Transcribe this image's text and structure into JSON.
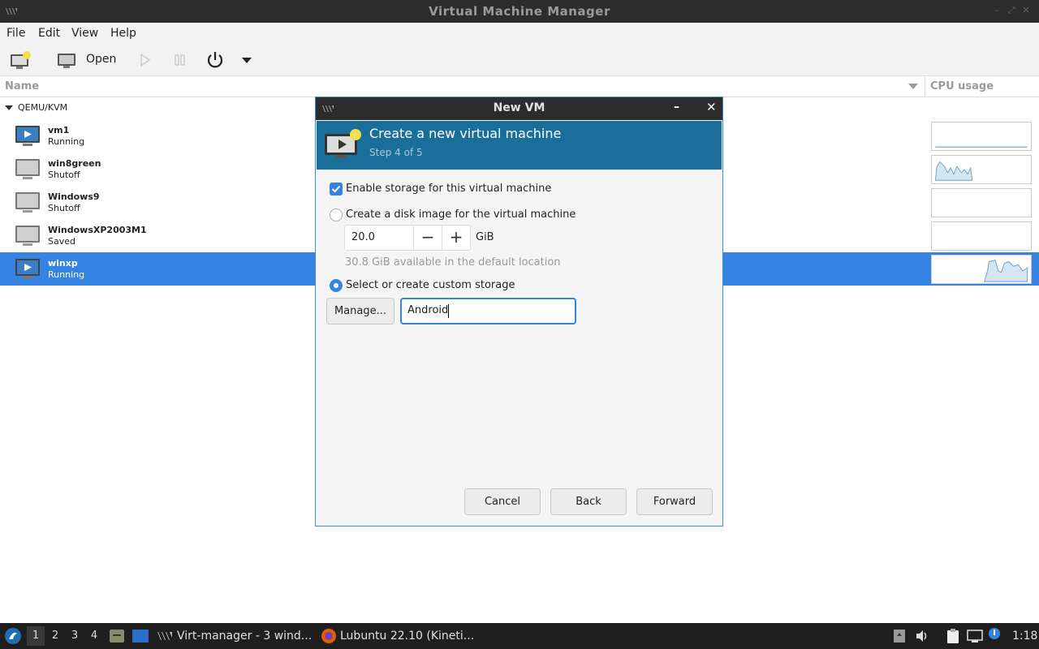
{
  "window": {
    "title": "Virtual Machine Manager"
  },
  "menu": {
    "file": "File",
    "edit": "Edit",
    "view": "View",
    "help": "Help"
  },
  "toolbar": {
    "open_label": "Open"
  },
  "columns": {
    "name": "Name",
    "cpu": "CPU usage"
  },
  "vms": {
    "group": "QEMU/KVM",
    "items": [
      {
        "name": "vm1",
        "status": "Running"
      },
      {
        "name": "win8green",
        "status": "Shutoff"
      },
      {
        "name": "Windows9",
        "status": "Shutoff"
      },
      {
        "name": "WindowsXP2003M1",
        "status": "Saved"
      },
      {
        "name": "winxp",
        "status": "Running"
      }
    ]
  },
  "dialog": {
    "title": "New VM",
    "heading": "Create a new virtual machine",
    "step": "Step 4 of 5",
    "enable_storage": "Enable storage for this virtual machine",
    "create_disk": "Create a disk image for the virtual machine",
    "disk_size": "20.0",
    "disk_unit": "GiB",
    "available": "30.8 GiB available in the default location",
    "custom_storage": "Select or create custom storage",
    "manage": "Manage...",
    "storage_value": "Android",
    "cancel": "Cancel",
    "back": "Back",
    "forward": "Forward"
  },
  "taskbar": {
    "workspaces": [
      "1",
      "2",
      "3",
      "4"
    ],
    "task1": "Virt-manager - 3 wind...",
    "task2": "Lubuntu 22.10 (Kineti...",
    "clock": "1:18"
  },
  "colors": {
    "accent": "#3584e4",
    "banner": "#1a6e9a",
    "titlebar": "#2c2c2c"
  }
}
